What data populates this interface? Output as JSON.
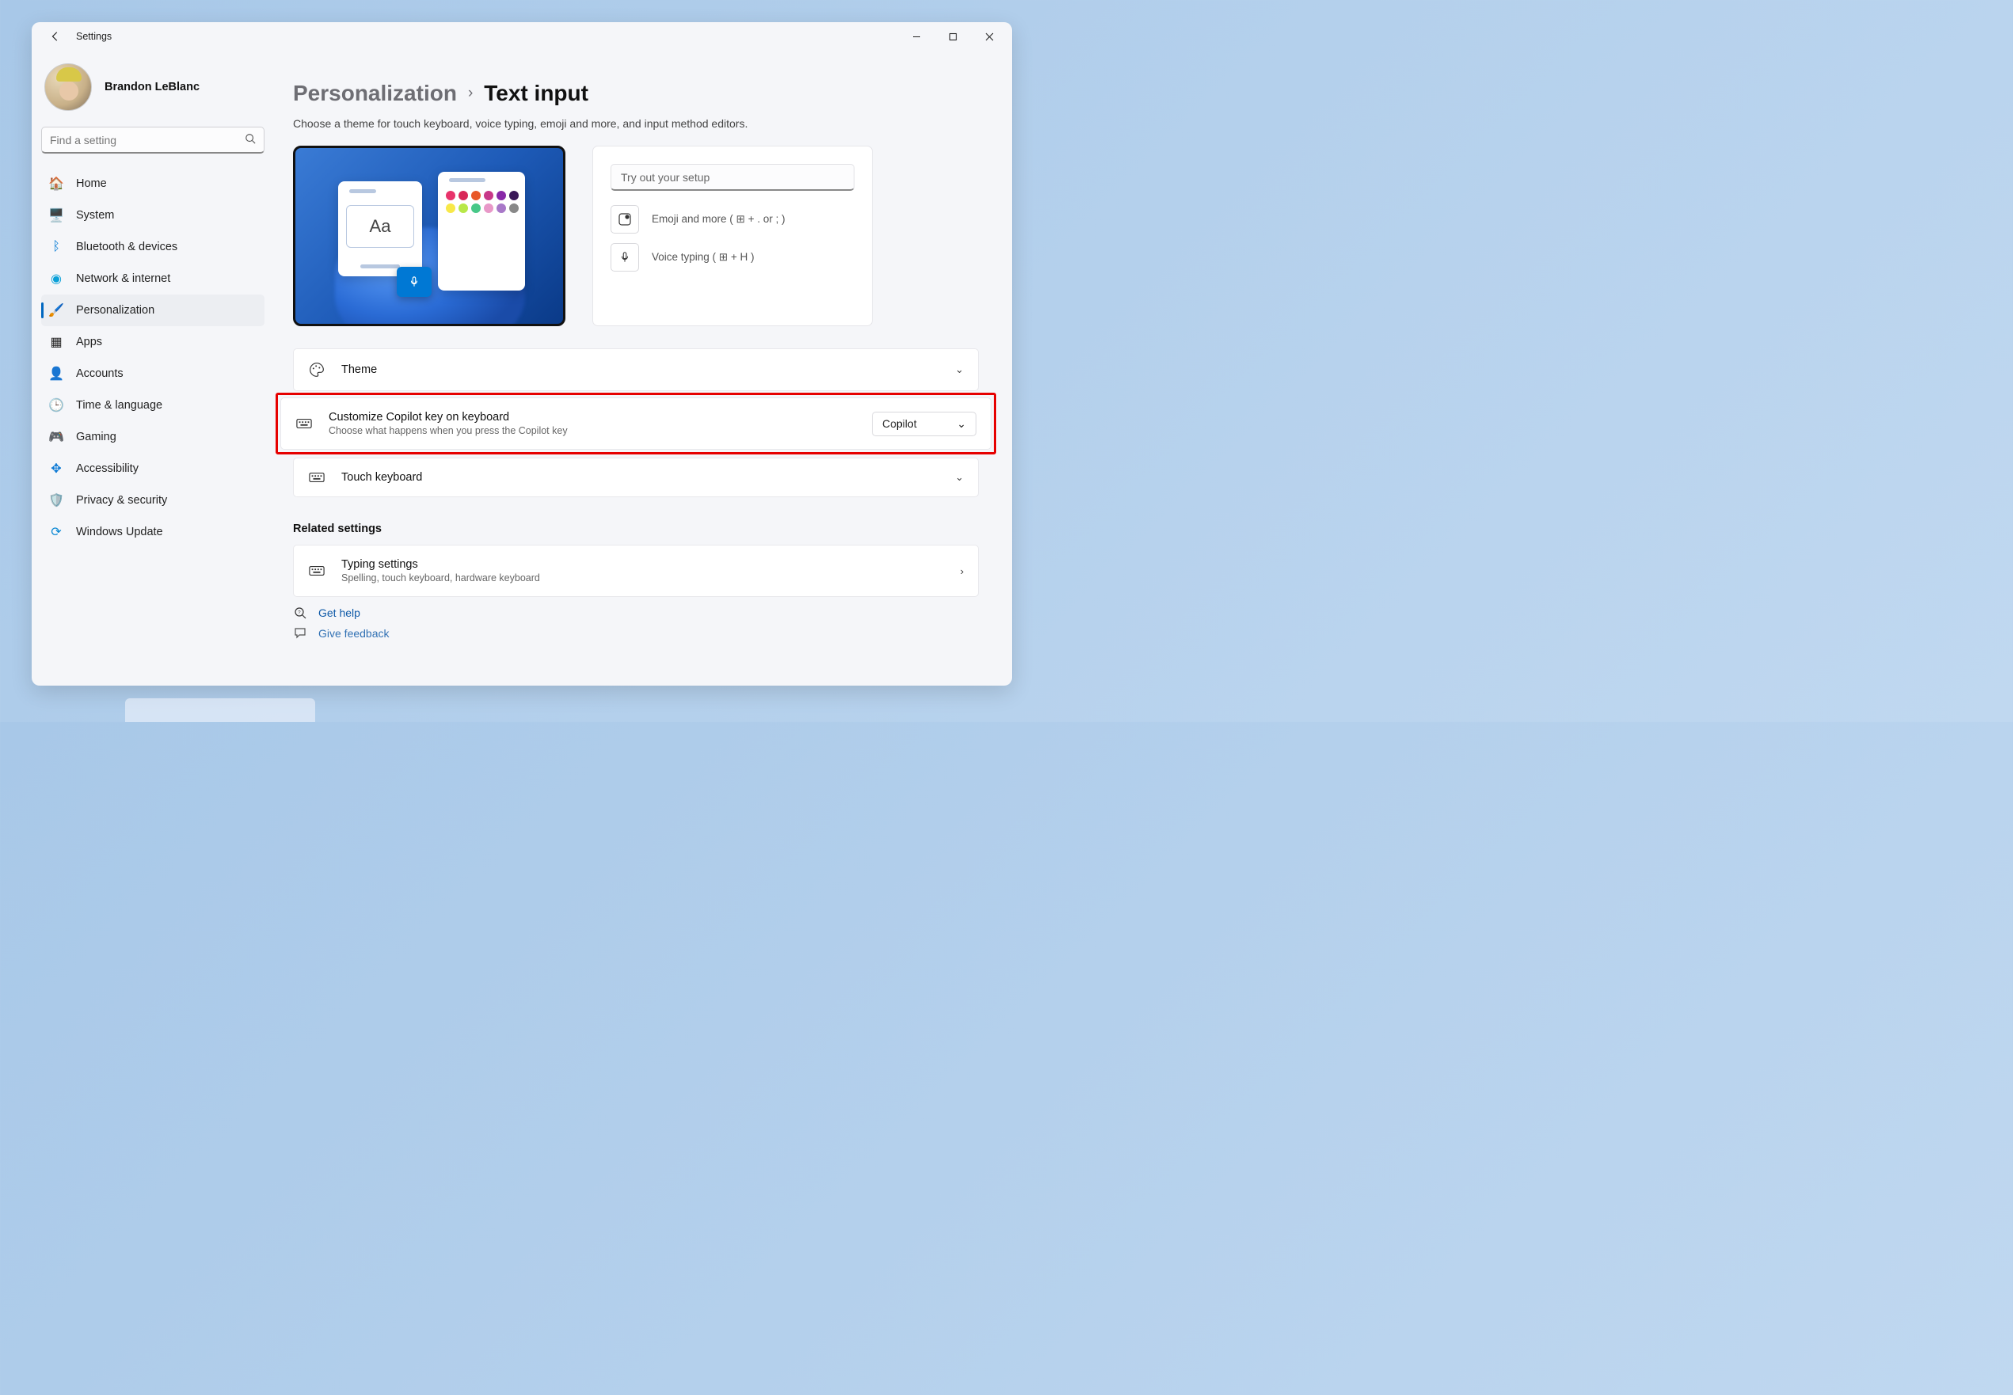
{
  "window": {
    "app_title": "Settings",
    "user_name": "Brandon LeBlanc"
  },
  "search": {
    "placeholder": "Find a setting"
  },
  "nav": {
    "home": "Home",
    "system": "System",
    "bluetooth": "Bluetooth & devices",
    "network": "Network & internet",
    "personalization": "Personalization",
    "apps": "Apps",
    "accounts": "Accounts",
    "time": "Time & language",
    "gaming": "Gaming",
    "accessibility": "Accessibility",
    "privacy": "Privacy & security",
    "update": "Windows Update"
  },
  "breadcrumb": {
    "parent": "Personalization",
    "current": "Text input"
  },
  "subtitle": "Choose a theme for touch keyboard, voice typing, emoji and more, and input method editors.",
  "preview_sample": "Aa",
  "tryout": {
    "placeholder": "Try out your setup",
    "emoji_label": "Emoji and more ( ⊞ + . or ; )",
    "voice_label": "Voice typing ( ⊞ + H )"
  },
  "cards": {
    "theme": {
      "title": "Theme"
    },
    "copilot": {
      "title": "Customize Copilot key on keyboard",
      "sub": "Choose what happens when you press the Copilot key",
      "value": "Copilot"
    },
    "touch": {
      "title": "Touch keyboard"
    }
  },
  "related_heading": "Related settings",
  "typing": {
    "title": "Typing settings",
    "sub": "Spelling, touch keyboard, hardware keyboard"
  },
  "help": "Get help",
  "feedback": "Give feedback"
}
